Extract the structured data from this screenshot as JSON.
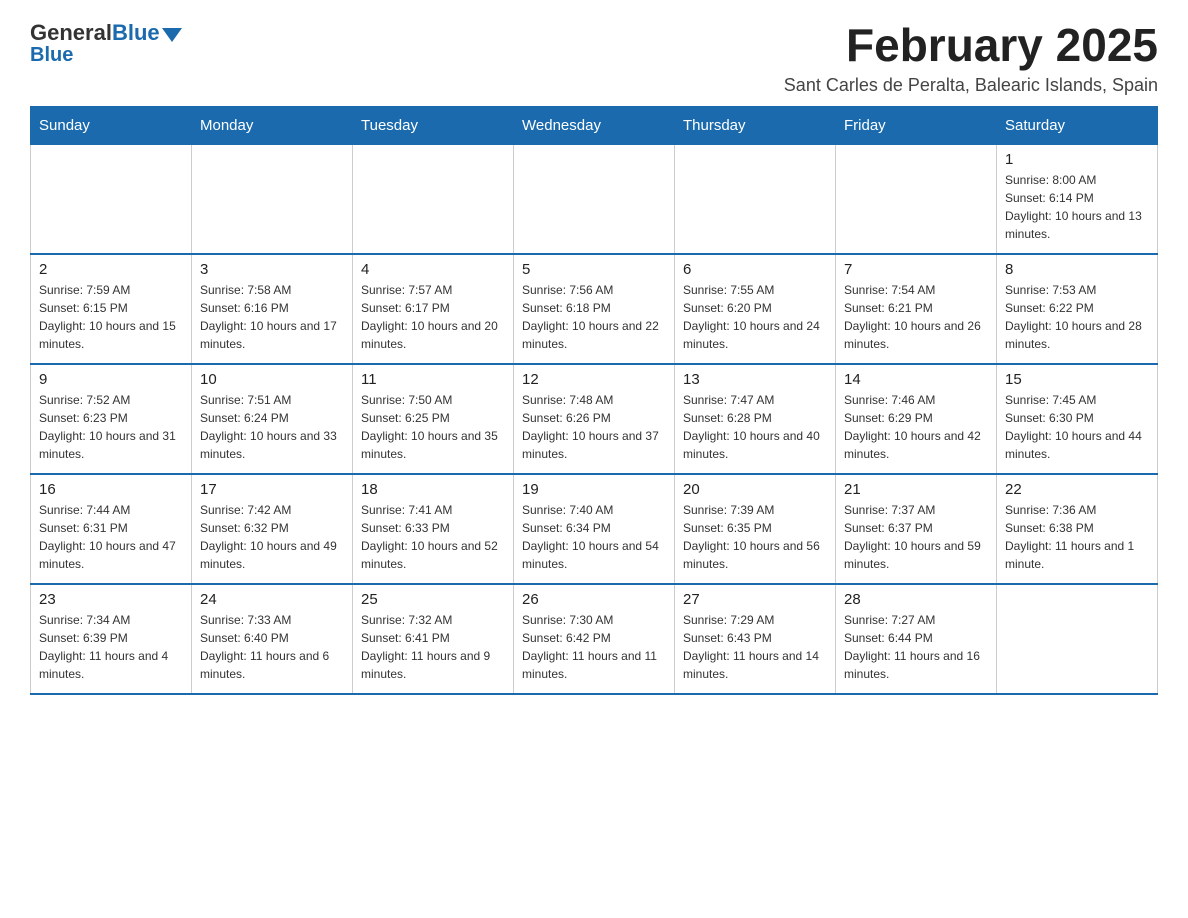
{
  "header": {
    "logo_general": "General",
    "logo_blue": "Blue",
    "month_title": "February 2025",
    "location": "Sant Carles de Peralta, Balearic Islands, Spain"
  },
  "weekdays": [
    "Sunday",
    "Monday",
    "Tuesday",
    "Wednesday",
    "Thursday",
    "Friday",
    "Saturday"
  ],
  "weeks": [
    [
      {
        "day": "",
        "info": ""
      },
      {
        "day": "",
        "info": ""
      },
      {
        "day": "",
        "info": ""
      },
      {
        "day": "",
        "info": ""
      },
      {
        "day": "",
        "info": ""
      },
      {
        "day": "",
        "info": ""
      },
      {
        "day": "1",
        "info": "Sunrise: 8:00 AM\nSunset: 6:14 PM\nDaylight: 10 hours and 13 minutes."
      }
    ],
    [
      {
        "day": "2",
        "info": "Sunrise: 7:59 AM\nSunset: 6:15 PM\nDaylight: 10 hours and 15 minutes."
      },
      {
        "day": "3",
        "info": "Sunrise: 7:58 AM\nSunset: 6:16 PM\nDaylight: 10 hours and 17 minutes."
      },
      {
        "day": "4",
        "info": "Sunrise: 7:57 AM\nSunset: 6:17 PM\nDaylight: 10 hours and 20 minutes."
      },
      {
        "day": "5",
        "info": "Sunrise: 7:56 AM\nSunset: 6:18 PM\nDaylight: 10 hours and 22 minutes."
      },
      {
        "day": "6",
        "info": "Sunrise: 7:55 AM\nSunset: 6:20 PM\nDaylight: 10 hours and 24 minutes."
      },
      {
        "day": "7",
        "info": "Sunrise: 7:54 AM\nSunset: 6:21 PM\nDaylight: 10 hours and 26 minutes."
      },
      {
        "day": "8",
        "info": "Sunrise: 7:53 AM\nSunset: 6:22 PM\nDaylight: 10 hours and 28 minutes."
      }
    ],
    [
      {
        "day": "9",
        "info": "Sunrise: 7:52 AM\nSunset: 6:23 PM\nDaylight: 10 hours and 31 minutes."
      },
      {
        "day": "10",
        "info": "Sunrise: 7:51 AM\nSunset: 6:24 PM\nDaylight: 10 hours and 33 minutes."
      },
      {
        "day": "11",
        "info": "Sunrise: 7:50 AM\nSunset: 6:25 PM\nDaylight: 10 hours and 35 minutes."
      },
      {
        "day": "12",
        "info": "Sunrise: 7:48 AM\nSunset: 6:26 PM\nDaylight: 10 hours and 37 minutes."
      },
      {
        "day": "13",
        "info": "Sunrise: 7:47 AM\nSunset: 6:28 PM\nDaylight: 10 hours and 40 minutes."
      },
      {
        "day": "14",
        "info": "Sunrise: 7:46 AM\nSunset: 6:29 PM\nDaylight: 10 hours and 42 minutes."
      },
      {
        "day": "15",
        "info": "Sunrise: 7:45 AM\nSunset: 6:30 PM\nDaylight: 10 hours and 44 minutes."
      }
    ],
    [
      {
        "day": "16",
        "info": "Sunrise: 7:44 AM\nSunset: 6:31 PM\nDaylight: 10 hours and 47 minutes."
      },
      {
        "day": "17",
        "info": "Sunrise: 7:42 AM\nSunset: 6:32 PM\nDaylight: 10 hours and 49 minutes."
      },
      {
        "day": "18",
        "info": "Sunrise: 7:41 AM\nSunset: 6:33 PM\nDaylight: 10 hours and 52 minutes."
      },
      {
        "day": "19",
        "info": "Sunrise: 7:40 AM\nSunset: 6:34 PM\nDaylight: 10 hours and 54 minutes."
      },
      {
        "day": "20",
        "info": "Sunrise: 7:39 AM\nSunset: 6:35 PM\nDaylight: 10 hours and 56 minutes."
      },
      {
        "day": "21",
        "info": "Sunrise: 7:37 AM\nSunset: 6:37 PM\nDaylight: 10 hours and 59 minutes."
      },
      {
        "day": "22",
        "info": "Sunrise: 7:36 AM\nSunset: 6:38 PM\nDaylight: 11 hours and 1 minute."
      }
    ],
    [
      {
        "day": "23",
        "info": "Sunrise: 7:34 AM\nSunset: 6:39 PM\nDaylight: 11 hours and 4 minutes."
      },
      {
        "day": "24",
        "info": "Sunrise: 7:33 AM\nSunset: 6:40 PM\nDaylight: 11 hours and 6 minutes."
      },
      {
        "day": "25",
        "info": "Sunrise: 7:32 AM\nSunset: 6:41 PM\nDaylight: 11 hours and 9 minutes."
      },
      {
        "day": "26",
        "info": "Sunrise: 7:30 AM\nSunset: 6:42 PM\nDaylight: 11 hours and 11 minutes."
      },
      {
        "day": "27",
        "info": "Sunrise: 7:29 AM\nSunset: 6:43 PM\nDaylight: 11 hours and 14 minutes."
      },
      {
        "day": "28",
        "info": "Sunrise: 7:27 AM\nSunset: 6:44 PM\nDaylight: 11 hours and 16 minutes."
      },
      {
        "day": "",
        "info": ""
      }
    ]
  ]
}
